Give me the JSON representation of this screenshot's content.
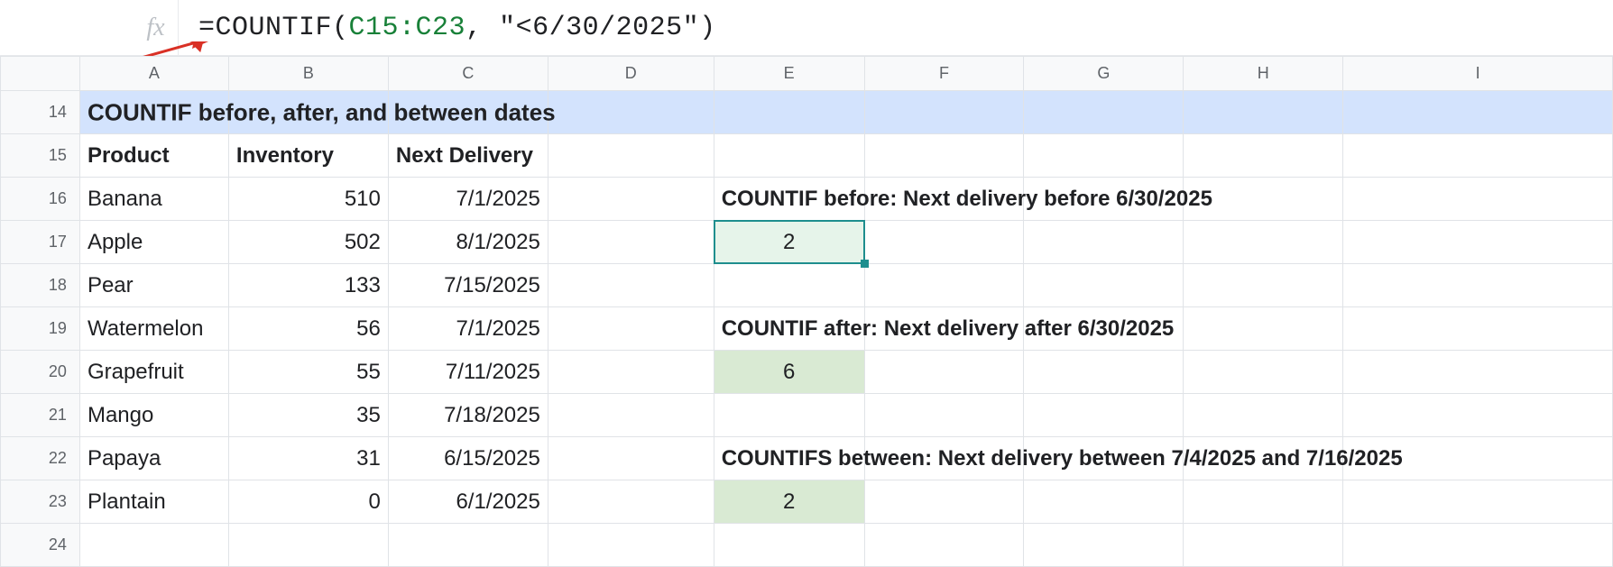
{
  "formula_bar": {
    "fx_label": "fx",
    "prefix": "=COUNTIF(",
    "ref": "C15:C23",
    "suffix": ", \"<6/30/2025\")"
  },
  "columns": [
    "A",
    "B",
    "C",
    "D",
    "E",
    "F",
    "G",
    "H",
    "I"
  ],
  "row_numbers": [
    "14",
    "15",
    "16",
    "17",
    "18",
    "19",
    "20",
    "21",
    "22",
    "23",
    "24"
  ],
  "title": "COUNTIF before, after, and between dates",
  "headers": {
    "a": "Product",
    "b": "Inventory",
    "c": "Next Delivery"
  },
  "products": [
    {
      "name": "Banana",
      "inv": "510",
      "date": "7/1/2025"
    },
    {
      "name": "Apple",
      "inv": "502",
      "date": "8/1/2025"
    },
    {
      "name": "Pear",
      "inv": "133",
      "date": "7/15/2025"
    },
    {
      "name": "Watermelon",
      "inv": "56",
      "date": "7/1/2025"
    },
    {
      "name": "Grapefruit",
      "inv": "55",
      "date": "7/11/2025"
    },
    {
      "name": "Mango",
      "inv": "35",
      "date": "7/18/2025"
    },
    {
      "name": "Papaya",
      "inv": "31",
      "date": "6/15/2025"
    },
    {
      "name": "Plantain",
      "inv": "0",
      "date": "6/1/2025"
    }
  ],
  "notes": {
    "before_label": "COUNTIF before: Next delivery before 6/30/2025",
    "before_result": "2",
    "after_label": "COUNTIF after: Next delivery after 6/30/2025",
    "after_result": "6",
    "between_label": "COUNTIFS between: Next delivery between 7/4/2025 and 7/16/2025",
    "between_result": "2"
  }
}
